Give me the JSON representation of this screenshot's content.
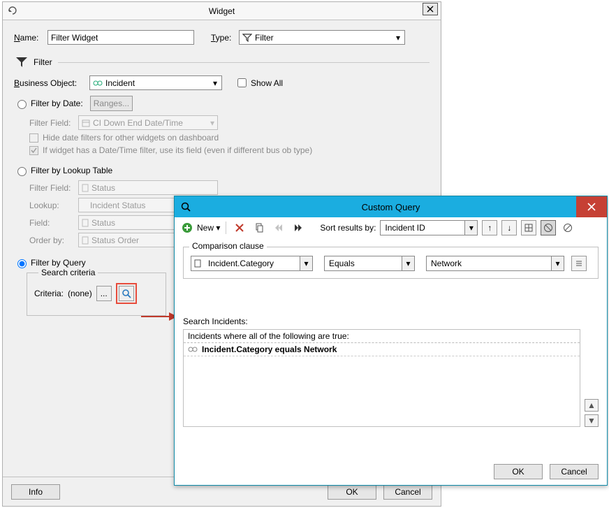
{
  "widget": {
    "title": "Widget",
    "name_label": "Name:",
    "name_value": "Filter Widget",
    "type_label": "Type:",
    "type_value": "Filter",
    "filter_section_label": "Filter",
    "business_object_label": "Business Object:",
    "business_object_value": "Incident",
    "show_all_label": "Show All",
    "filter_by_date_label": "Filter by Date:",
    "ranges_button": "Ranges...",
    "filter_field_label": "Filter Field:",
    "filter_field_value": "CI Down End Date/Time",
    "hide_date_filters_label": "Hide date filters for other widgets on dashboard",
    "use_dt_filter_label": "If widget has a Date/Time filter, use its field (even if different bus ob type)",
    "filter_by_lookup_label": "Filter by Lookup Table",
    "lookup_filter_field_label": "Filter Field:",
    "lookup_filter_field_value": "Status",
    "lookup_label": "Lookup:",
    "lookup_value": "Incident Status",
    "field_label": "Field:",
    "field_value": "Status",
    "orderby_label": "Order by:",
    "orderby_value": "Status Order",
    "filter_by_query_label": "Filter by Query",
    "search_criteria_label": "Search criteria",
    "criteria_label": "Criteria:",
    "criteria_value": "(none)",
    "ellipsis_button": "...",
    "info_button": "Info",
    "ok_button": "OK",
    "cancel_button": "Cancel"
  },
  "custom_query": {
    "title": "Custom Query",
    "new_label": "New",
    "sort_label": "Sort results by:",
    "sort_value": "Incident ID",
    "comparison_legend": "Comparison clause",
    "field_value": "Incident.Category",
    "operator_value": "Equals",
    "value_value": "Network",
    "search_incidents_label": "Search Incidents:",
    "header_text": "Incidents where all of the following are true:",
    "row_text": "Incident.Category equals Network",
    "ok_button": "OK",
    "cancel_button": "Cancel"
  }
}
